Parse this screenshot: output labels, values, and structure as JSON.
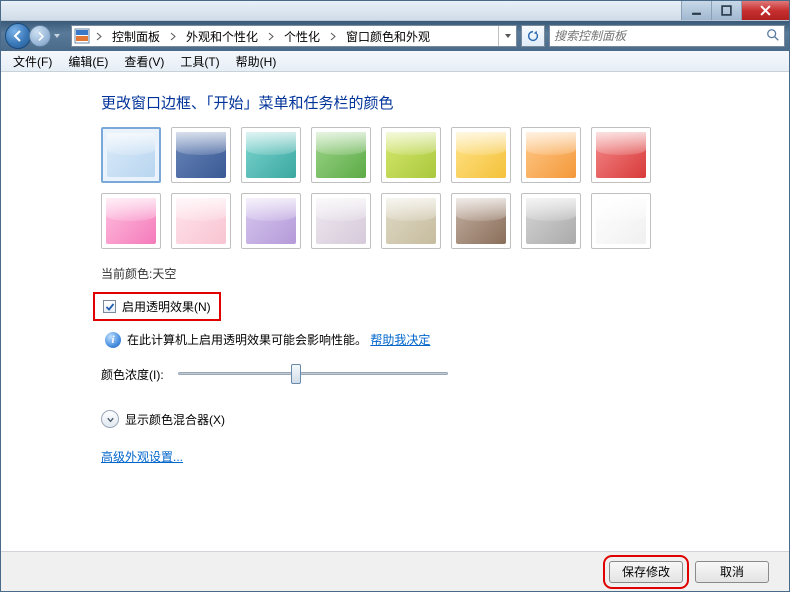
{
  "breadcrumb": {
    "seg1": "控制面板",
    "seg2": "外观和个性化",
    "seg3": "个性化",
    "seg4": "窗口颜色和外观"
  },
  "search": {
    "placeholder": "搜索控制面板"
  },
  "menu": {
    "file": "文件(F)",
    "edit": "编辑(E)",
    "view": "查看(V)",
    "tools": "工具(T)",
    "help": "帮助(H)"
  },
  "heading": "更改窗口边框、「开始」菜单和任务栏的颜色",
  "colors": [
    {
      "name": "sky",
      "bg": "linear-gradient(135deg,#dbeaf9 0%,#b8d6f0 100%)",
      "selected": true
    },
    {
      "name": "twilight",
      "bg": "linear-gradient(135deg,#6a86b8 0%,#3a5a96 100%)"
    },
    {
      "name": "sea",
      "bg": "linear-gradient(135deg,#7ed4d0 0%,#3aa8a0 100%)"
    },
    {
      "name": "leaf",
      "bg": "linear-gradient(135deg,#9ed48a 0%,#5cab46 100%)"
    },
    {
      "name": "lime",
      "bg": "linear-gradient(135deg,#d6e870 0%,#aac83c 100%)"
    },
    {
      "name": "sun",
      "bg": "linear-gradient(135deg,#ffe38a 0%,#f4c23a 100%)"
    },
    {
      "name": "pumpkin",
      "bg": "linear-gradient(135deg,#ffca8a 0%,#f4983a 100%)"
    },
    {
      "name": "ruby",
      "bg": "linear-gradient(135deg,#f48a8a 0%,#d83a3a 100%)"
    },
    {
      "name": "fuchsia",
      "bg": "linear-gradient(135deg,#ffc0e0 0%,#f47aba 100%)"
    },
    {
      "name": "blush",
      "bg": "linear-gradient(135deg,#ffe4ec 0%,#f8c4d2 100%)"
    },
    {
      "name": "violet",
      "bg": "linear-gradient(135deg,#d8c8f0 0%,#b49ad8 100%)"
    },
    {
      "name": "lavender",
      "bg": "linear-gradient(135deg,#eee8f0 0%,#d6cada 100%)"
    },
    {
      "name": "taupe",
      "bg": "linear-gradient(135deg,#e0dac6 0%,#c6bc9e 100%)"
    },
    {
      "name": "chocolate",
      "bg": "linear-gradient(135deg,#c4b0a2 0%,#8a6e5a 100%)"
    },
    {
      "name": "slate",
      "bg": "linear-gradient(135deg,#d6d6d6 0%,#aaaaaa 100%)"
    },
    {
      "name": "frost",
      "bg": "linear-gradient(135deg,#ffffff 0%,#f0f0f0 100%)"
    }
  ],
  "current_label": "当前颜色: ",
  "current_value": "天空",
  "transparency_checkbox": "启用透明效果(N)",
  "perf_note": "在此计算机上启用透明效果可能会影响性能。",
  "perf_link": "帮助我决定",
  "intensity_label": "颜色浓度(I):",
  "mixer_label": "显示颜色混合器(X)",
  "advanced_link": "高级外观设置...",
  "buttons": {
    "save": "保存修改",
    "cancel": "取消"
  }
}
